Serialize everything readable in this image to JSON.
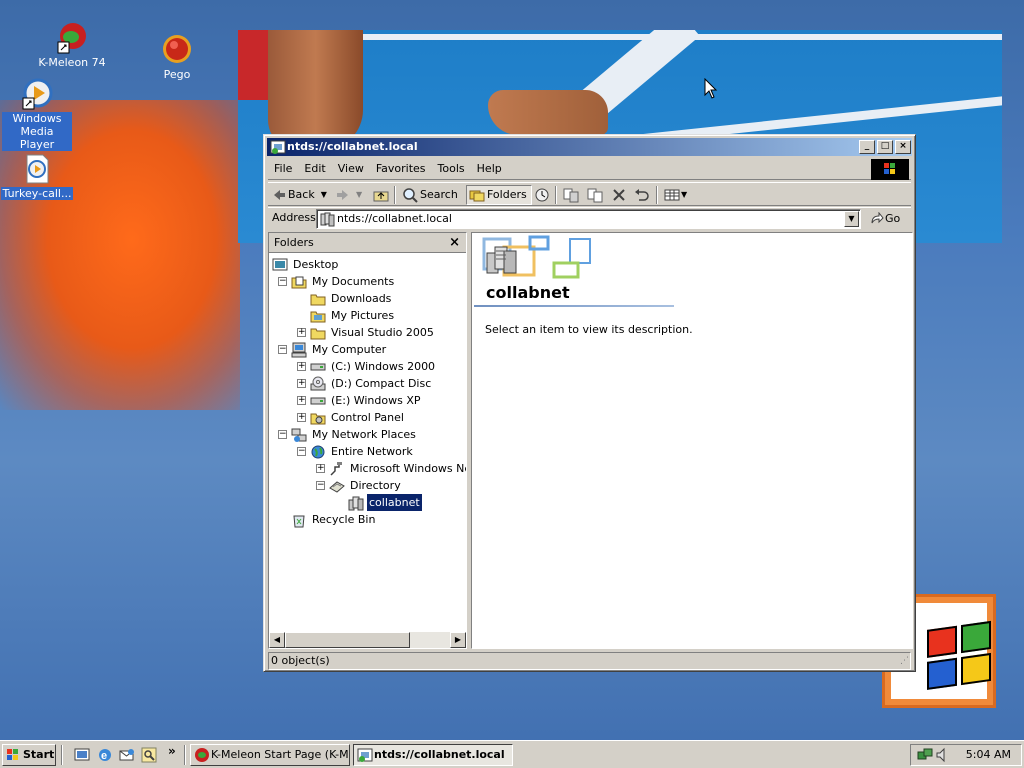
{
  "desktop": {
    "icons": [
      {
        "label": "K-Meleon 74",
        "icon": "k-meleon-icon"
      },
      {
        "label": "Pego",
        "icon": "pego-icon"
      },
      {
        "label": "Windows Media Player",
        "icon": "media-player-icon"
      },
      {
        "label": "Turkey-call...",
        "icon": "media-file-icon"
      }
    ]
  },
  "window": {
    "title": "ntds://collabnet.local",
    "menu": [
      "File",
      "Edit",
      "View",
      "Favorites",
      "Tools",
      "Help"
    ],
    "toolbar": {
      "back_label": "Back",
      "search_label": "Search",
      "folders_label": "Folders"
    },
    "address": {
      "label": "Address",
      "value": "ntds://collabnet.local",
      "go_label": "Go"
    },
    "folders_pane": {
      "header": "Folders",
      "tree": [
        {
          "label": "Desktop",
          "icon": "desktop-icon",
          "level": 0
        },
        {
          "label": "My Documents",
          "icon": "my-documents-icon",
          "level": 1,
          "expander": "minus"
        },
        {
          "label": "Downloads",
          "icon": "folder-icon",
          "level": 2
        },
        {
          "label": "My Pictures",
          "icon": "pictures-folder-icon",
          "level": 2
        },
        {
          "label": "Visual Studio 2005",
          "icon": "folder-icon",
          "level": 2,
          "expander": "plus"
        },
        {
          "label": "My Computer",
          "icon": "my-computer-icon",
          "level": 1,
          "expander": "minus"
        },
        {
          "label": "(C:) Windows 2000",
          "icon": "drive-icon",
          "level": 2,
          "expander": "plus"
        },
        {
          "label": "(D:) Compact Disc",
          "icon": "cd-drive-icon",
          "level": 2,
          "expander": "plus"
        },
        {
          "label": "(E:) Windows XP",
          "icon": "drive-icon",
          "level": 2,
          "expander": "plus"
        },
        {
          "label": "Control Panel",
          "icon": "control-panel-icon",
          "level": 2,
          "expander": "plus"
        },
        {
          "label": "My Network Places",
          "icon": "network-places-icon",
          "level": 1,
          "expander": "minus"
        },
        {
          "label": "Entire Network",
          "icon": "globe-icon",
          "level": 2,
          "expander": "minus"
        },
        {
          "label": "Microsoft Windows Netw",
          "icon": "network-icon",
          "level": 3,
          "expander": "plus"
        },
        {
          "label": "Directory",
          "icon": "directory-icon",
          "level": 3,
          "expander": "minus"
        },
        {
          "label": "collabnet",
          "icon": "domain-icon",
          "level": 4,
          "selected": true
        },
        {
          "label": "Recycle Bin",
          "icon": "recycle-bin-icon",
          "level": 1
        }
      ]
    },
    "content": {
      "title": "collabnet",
      "description": "Select an item to view its description."
    },
    "status": "0 object(s)"
  },
  "taskbar": {
    "start_label": "Start",
    "tasks": [
      {
        "label": "K-Meleon Start Page (K-M...",
        "active": false
      },
      {
        "label": "ntds://collabnet.local",
        "active": true
      }
    ],
    "clock": "5:04 AM",
    "quick_launch_chevron": "»"
  }
}
